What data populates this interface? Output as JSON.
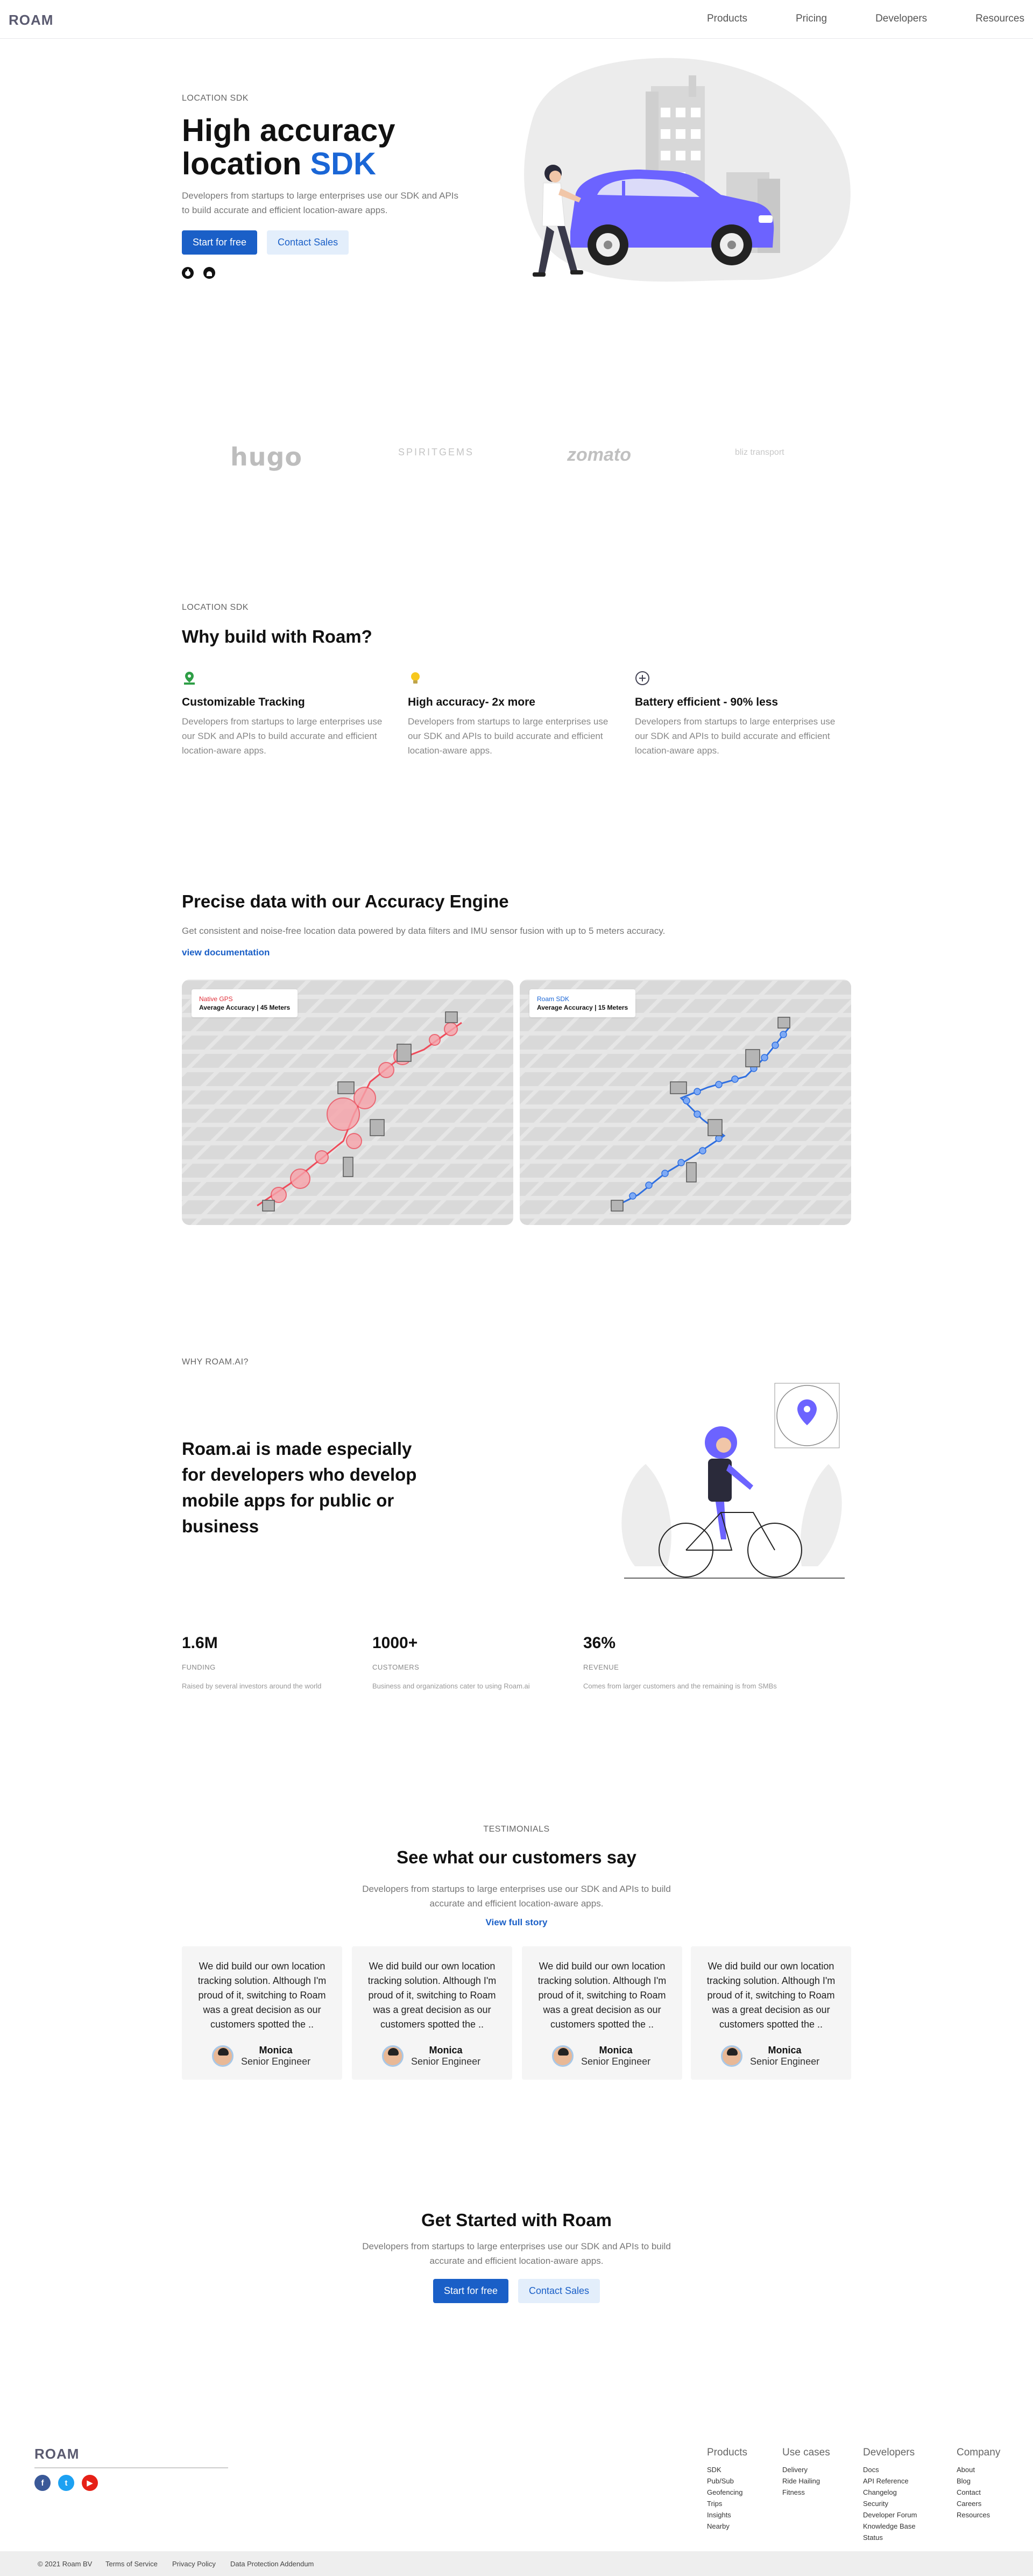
{
  "header": {
    "logo": "ROAM",
    "nav": [
      "Products",
      "Pricing",
      "Developers",
      "Resources"
    ]
  },
  "hero": {
    "eyebrow": "LOCATION SDK",
    "title_line1": "High accuracy",
    "title_line2_plain": "location ",
    "title_line2_accent": "SDK",
    "lead": "Developers from startups to large enterprises use our SDK and APIs to build accurate and efficient location-aware apps.",
    "primary_cta": "Start for free",
    "secondary_cta": "Contact Sales",
    "store_icons": [
      "apple-icon",
      "android-icon"
    ]
  },
  "logos": [
    "hugo",
    "SPIRITGEMS",
    "zomato",
    "bliz transport"
  ],
  "why": {
    "eyebrow": "LOCATION SDK",
    "title": "Why build with Roam?",
    "features": [
      {
        "icon": "map-pin-icon",
        "title": "Customizable Tracking",
        "text": "Developers from startups to large enterprises use our SDK and APIs to build accurate and efficient location-aware apps."
      },
      {
        "icon": "lightbulb-icon",
        "title": "High accuracy- 2x more",
        "text": "Developers from startups to large enterprises use our SDK and APIs to build accurate and efficient location-aware apps."
      },
      {
        "icon": "battery-icon",
        "title": "Battery efficient - 90% less",
        "text": "Developers from startups to large enterprises use our SDK and APIs to build accurate and efficient location-aware apps."
      }
    ]
  },
  "accuracy": {
    "title": "Precise data with our Accuracy Engine",
    "lead": "Get consistent and noise-free location data powered by data filters and IMU sensor fusion with up to 5 meters accuracy.",
    "link": "view documentation",
    "maps": [
      {
        "label": "Native GPS",
        "label_color": "#e0303a",
        "accuracy": "Average Accuracy | 45 Meters"
      },
      {
        "label": "Roam SDK",
        "label_color": "#1a66d6",
        "accuracy": "Average Accuracy | 15 Meters"
      }
    ]
  },
  "about": {
    "eyebrow": "WHY ROAM.AI?",
    "title": "Roam.ai is made especially for developers who develop mobile apps for public or business",
    "stats": [
      {
        "value": "1.6M",
        "label": "FUNDING",
        "desc": "Raised by several investors around the world"
      },
      {
        "value": "1000+",
        "label": "CUSTOMERS",
        "desc": "Business and organizations cater to using Roam.ai"
      },
      {
        "value": "36%",
        "label": "REVENUE",
        "desc": "Comes from larger customers and the remaining is from SMBs"
      }
    ]
  },
  "testimonials": {
    "eyebrow": "TESTIMONIALS",
    "title": "See what our customers say",
    "lead": "Developers from startups to large enterprises use our SDK and APIs to build accurate and efficient location-aware apps.",
    "link": "View full story",
    "cards": [
      {
        "quote": "We did build our own location tracking solution. Although I'm proud of it, switching to Roam was a great decision as our customers spotted the ..",
        "name": "Monica",
        "role": "Senior Engineer"
      },
      {
        "quote": "We did build our own location tracking solution. Although I'm proud of it, switching to Roam was a great decision as our customers spotted the ..",
        "name": "Monica",
        "role": "Senior Engineer"
      },
      {
        "quote": "We did build our own location tracking solution. Although I'm proud of it, switching to Roam was a great decision as our customers spotted the ..",
        "name": "Monica",
        "role": "Senior Engineer"
      },
      {
        "quote": "We did build our own location tracking solution. Although I'm proud of it, switching to Roam was a great decision as our customers spotted the ..",
        "name": "Monica",
        "role": "Senior Engineer"
      }
    ]
  },
  "cta": {
    "title": "Get Started with Roam",
    "lead": "Developers from startups to large enterprises use our SDK and APIs to build accurate and efficient location-aware apps.",
    "primary": "Start for free",
    "secondary": "Contact Sales"
  },
  "footer": {
    "logo": "ROAM",
    "social": [
      "facebook-icon",
      "twitter-icon",
      "youtube-icon"
    ],
    "columns": [
      {
        "title": "Products",
        "links": [
          "SDK",
          "Pub/Sub",
          "Geofencing",
          "Trips",
          "Insights",
          "Nearby"
        ]
      },
      {
        "title": "Use cases",
        "links": [
          "Delivery",
          "Ride Hailing",
          "Fitness"
        ]
      },
      {
        "title": "Developers",
        "links": [
          "Docs",
          "API Reference",
          "Changelog",
          "Security",
          "Developer Forum",
          "Knowledge Base",
          "Status"
        ]
      },
      {
        "title": "Company",
        "links": [
          "About",
          "Blog",
          "Contact",
          "Careers",
          "Resources"
        ]
      }
    ],
    "copyright": "© 2021 Roam BV",
    "legal": [
      "Terms of Service",
      "Privacy Policy",
      "Data Protection Addendum"
    ]
  }
}
